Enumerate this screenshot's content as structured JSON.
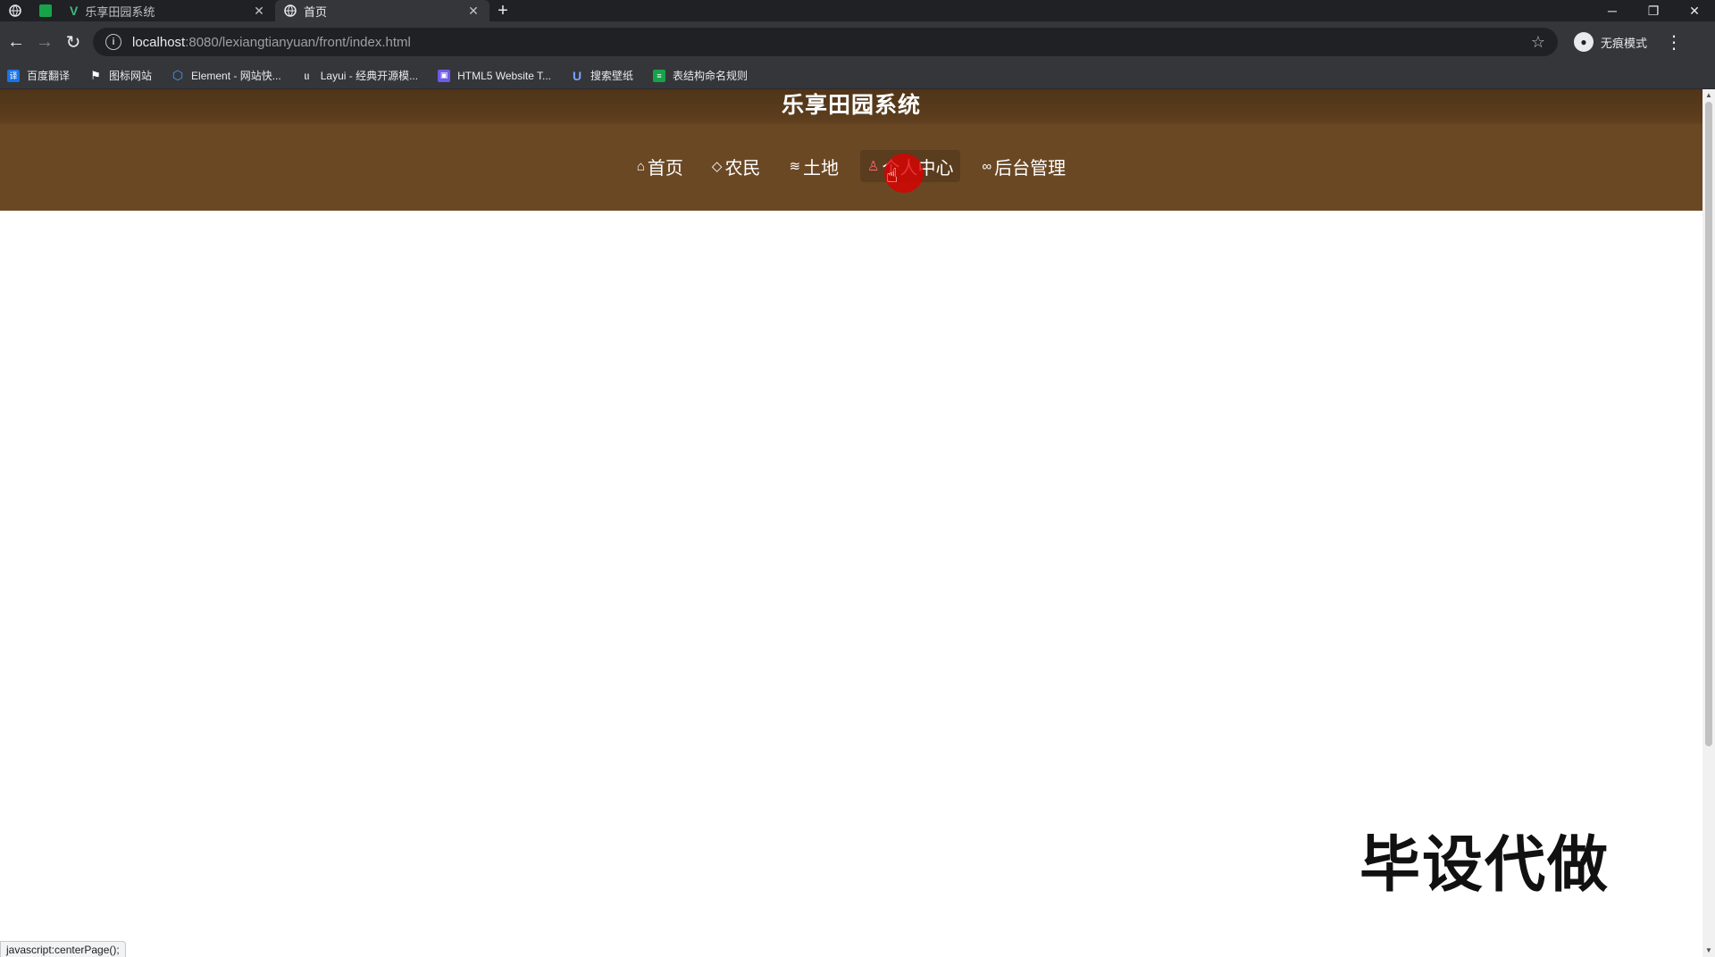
{
  "browser": {
    "tabs": [
      {
        "title": "乐享田园系统",
        "active": false
      },
      {
        "title": "首页",
        "active": true
      }
    ],
    "address": {
      "host": "localhost",
      "path": ":8080/lexiangtianyuan/front/index.html"
    },
    "profile_label": "无痕模式",
    "bookmarks": [
      {
        "label": "百度翻译",
        "color": "#1a73e8"
      },
      {
        "label": "图标网站",
        "color": "#444444"
      },
      {
        "label": "Element - 网站快...",
        "color": "#409eff"
      },
      {
        "label": "Layui - 经典开源模...",
        "color": "#555555"
      },
      {
        "label": "HTML5 Website T...",
        "color": "#6c5ce7"
      },
      {
        "label": "搜索壁纸",
        "color": "#3b5bdb"
      },
      {
        "label": "表结构命名规则",
        "color": "#16a34a"
      }
    ]
  },
  "site": {
    "title": "乐享田园系统",
    "nav": [
      {
        "label": "首页",
        "icon": "home-icon",
        "glyph": "⌂",
        "active": false
      },
      {
        "label": "农民",
        "icon": "tag-icon",
        "glyph": "🏷",
        "active": false
      },
      {
        "label": "土地",
        "icon": "layers-icon",
        "glyph": "≋",
        "active": false
      },
      {
        "label": "个人中心",
        "icon": "user-icon",
        "glyph": "♙",
        "active": true
      },
      {
        "label": "后台管理",
        "icon": "link-icon",
        "glyph": "🔗",
        "active": false
      }
    ]
  },
  "watermark": "毕设代做",
  "status_text": "javascript:centerPage();",
  "colors": {
    "header_bg": "#6b4824",
    "title_bar_bg": "#4f3418",
    "cursor_highlight": "#dc0000"
  }
}
